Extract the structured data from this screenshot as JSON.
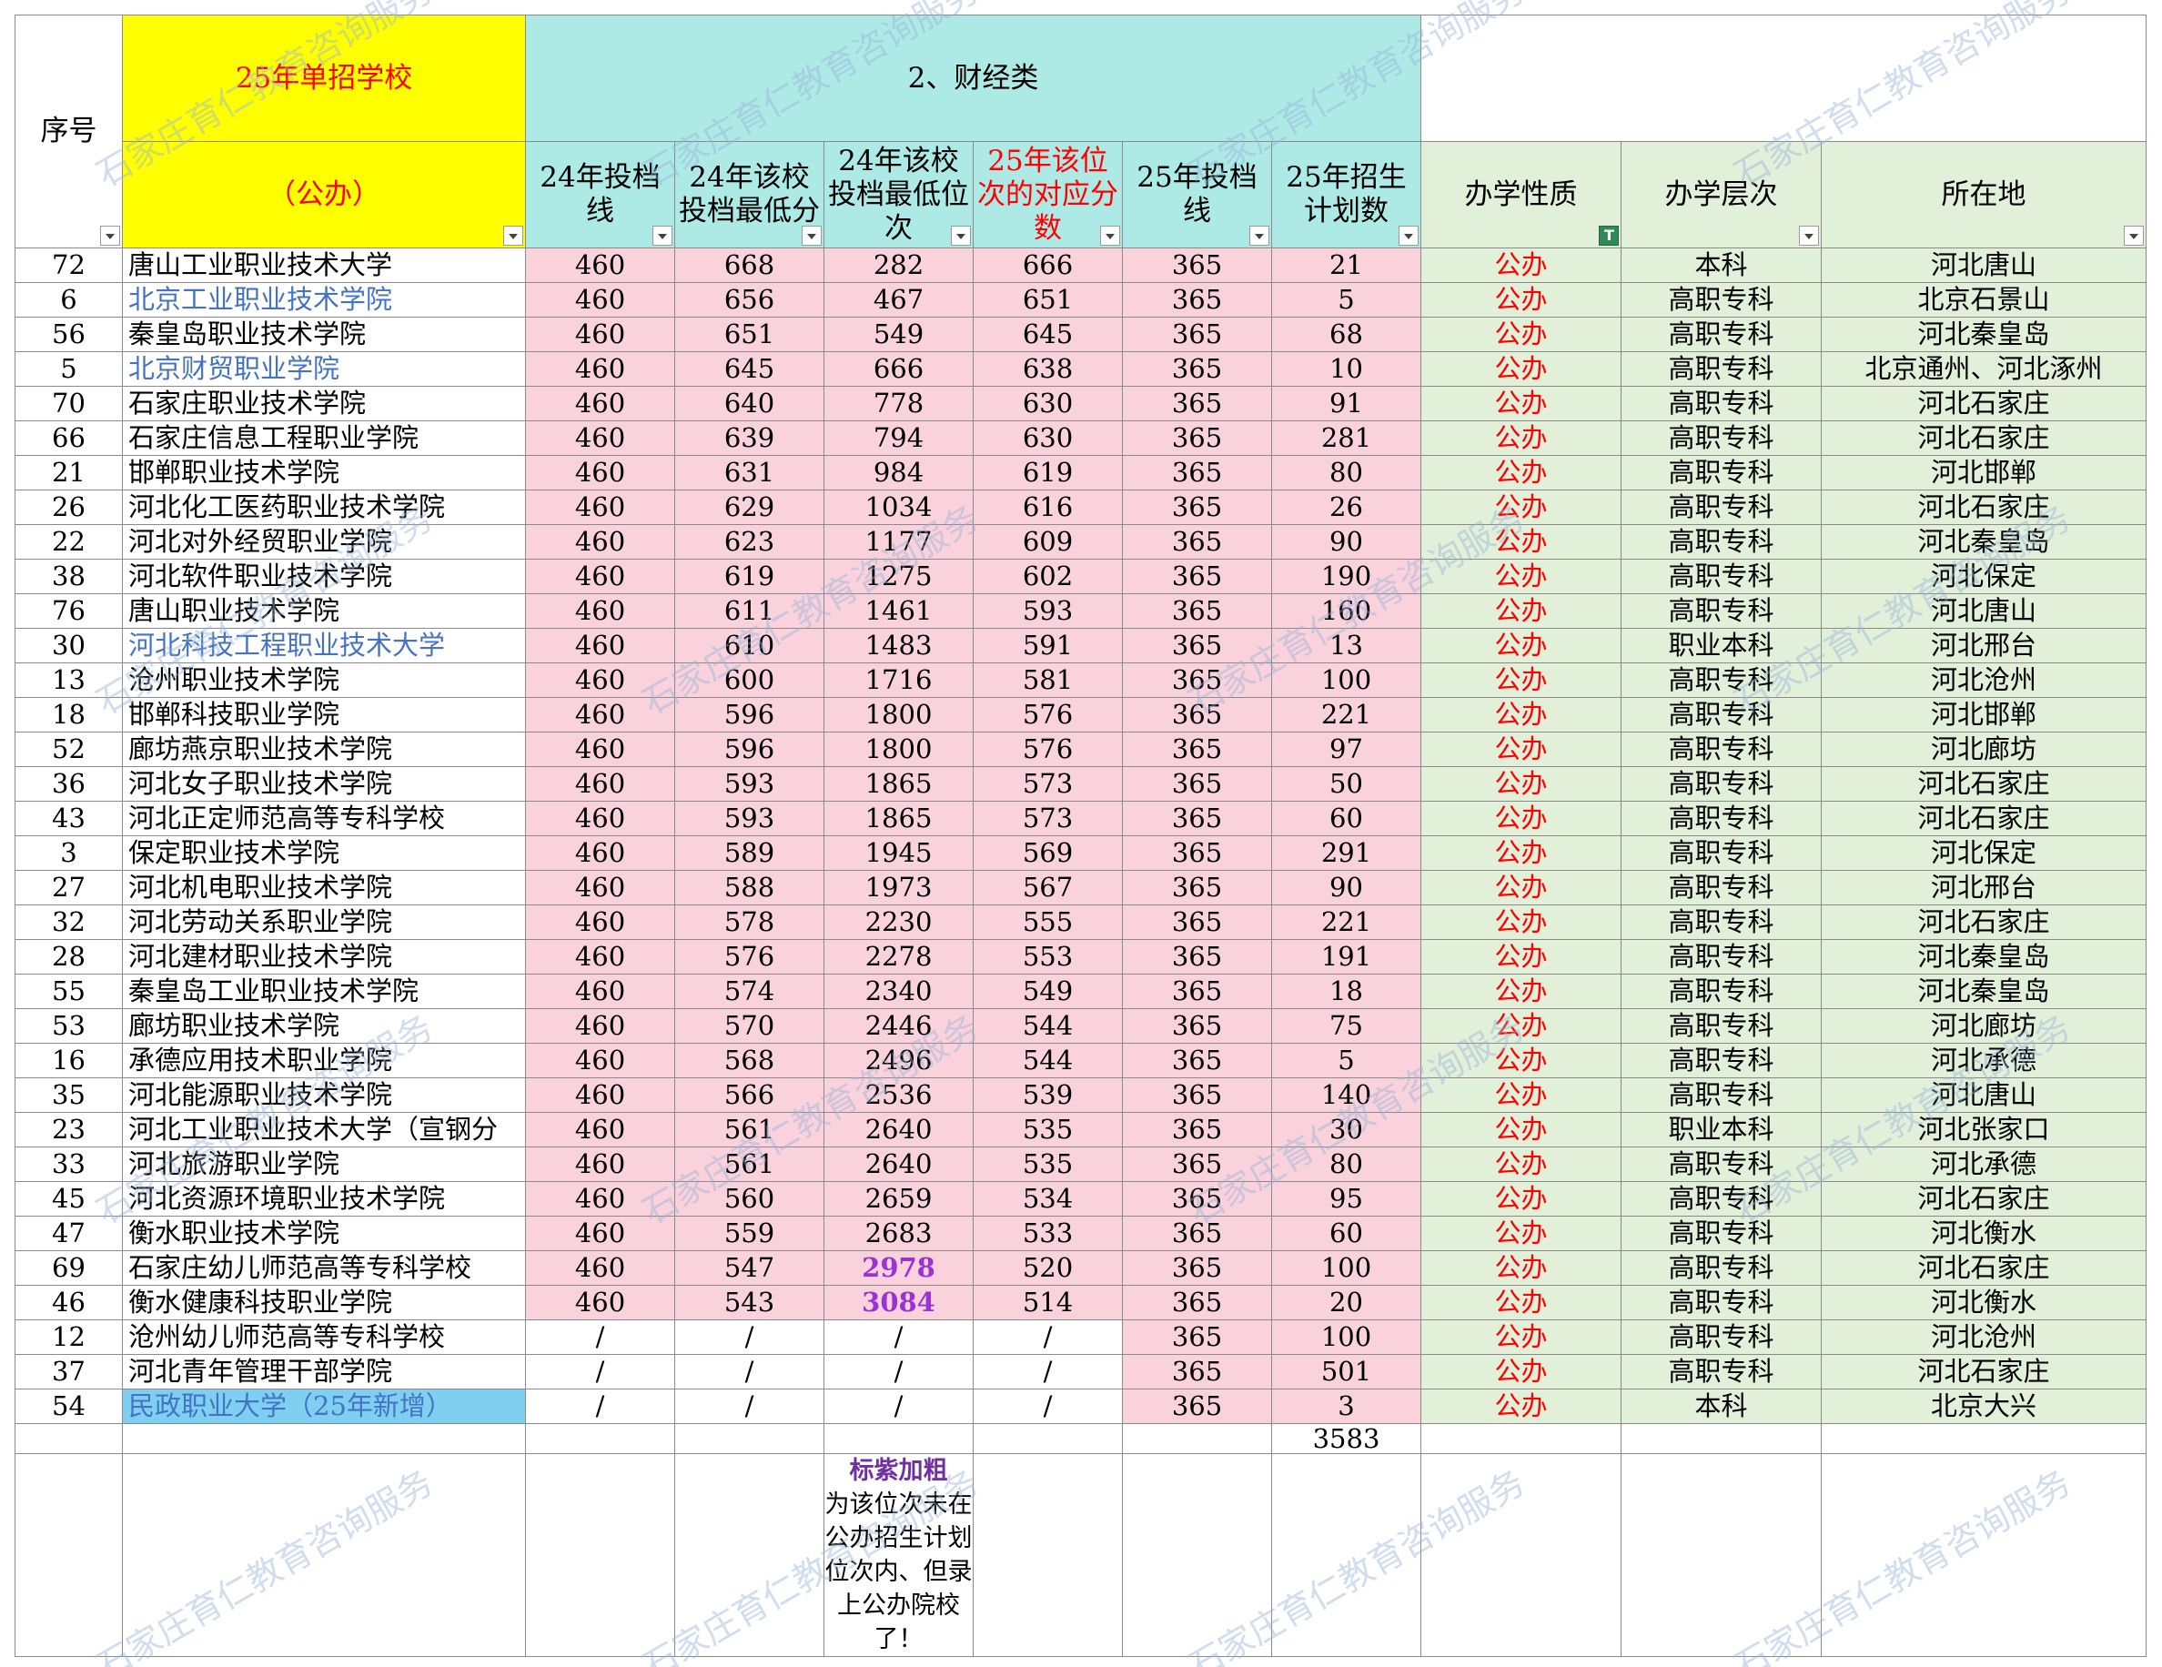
{
  "header": {
    "seq_label": "序号",
    "school_title": "25年单招学校",
    "school_sub": "（公办）",
    "category": "2、财经类",
    "col_24_line": "24年投档线",
    "col_24_min_score": "24年该校投档最低分",
    "col_24_min_rank": "24年该校投档最低位次",
    "col_25_score": "25年该位次的对应分数",
    "col_25_line": "25年投档线",
    "col_25_plan": "25年招生计划数",
    "col_type": "办学性质",
    "col_level": "办学层次",
    "col_location": "所在地"
  },
  "rows": [
    {
      "seq": "72",
      "name": "唐山工业职业技术大学",
      "line24": "460",
      "min24": "668",
      "rank24": "282",
      "score25": "666",
      "line25": "365",
      "plan25": "21",
      "type": "公办",
      "level": "本科",
      "loc": "河北唐山",
      "style": ""
    },
    {
      "seq": "6",
      "name": "北京工业职业技术学院",
      "line24": "460",
      "min24": "656",
      "rank24": "467",
      "score25": "651",
      "line25": "365",
      "plan25": "5",
      "type": "公办",
      "level": "高职专科",
      "loc": "北京石景山",
      "style": "link"
    },
    {
      "seq": "56",
      "name": "秦皇岛职业技术学院",
      "line24": "460",
      "min24": "651",
      "rank24": "549",
      "score25": "645",
      "line25": "365",
      "plan25": "68",
      "type": "公办",
      "level": "高职专科",
      "loc": "河北秦皇岛",
      "style": ""
    },
    {
      "seq": "5",
      "name": "北京财贸职业学院",
      "line24": "460",
      "min24": "645",
      "rank24": "666",
      "score25": "638",
      "line25": "365",
      "plan25": "10",
      "type": "公办",
      "level": "高职专科",
      "loc": "北京通州、河北涿州",
      "style": "link"
    },
    {
      "seq": "70",
      "name": "石家庄职业技术学院",
      "line24": "460",
      "min24": "640",
      "rank24": "778",
      "score25": "630",
      "line25": "365",
      "plan25": "91",
      "type": "公办",
      "level": "高职专科",
      "loc": "河北石家庄",
      "style": ""
    },
    {
      "seq": "66",
      "name": "石家庄信息工程职业学院",
      "line24": "460",
      "min24": "639",
      "rank24": "794",
      "score25": "630",
      "line25": "365",
      "plan25": "281",
      "type": "公办",
      "level": "高职专科",
      "loc": "河北石家庄",
      "style": ""
    },
    {
      "seq": "21",
      "name": "邯郸职业技术学院",
      "line24": "460",
      "min24": "631",
      "rank24": "984",
      "score25": "619",
      "line25": "365",
      "plan25": "80",
      "type": "公办",
      "level": "高职专科",
      "loc": "河北邯郸",
      "style": ""
    },
    {
      "seq": "26",
      "name": "河北化工医药职业技术学院",
      "line24": "460",
      "min24": "629",
      "rank24": "1034",
      "score25": "616",
      "line25": "365",
      "plan25": "26",
      "type": "公办",
      "level": "高职专科",
      "loc": "河北石家庄",
      "style": ""
    },
    {
      "seq": "22",
      "name": "河北对外经贸职业学院",
      "line24": "460",
      "min24": "623",
      "rank24": "1177",
      "score25": "609",
      "line25": "365",
      "plan25": "90",
      "type": "公办",
      "level": "高职专科",
      "loc": "河北秦皇岛",
      "style": ""
    },
    {
      "seq": "38",
      "name": "河北软件职业技术学院",
      "line24": "460",
      "min24": "619",
      "rank24": "1275",
      "score25": "602",
      "line25": "365",
      "plan25": "190",
      "type": "公办",
      "level": "高职专科",
      "loc": "河北保定",
      "style": ""
    },
    {
      "seq": "76",
      "name": "唐山职业技术学院",
      "line24": "460",
      "min24": "611",
      "rank24": "1461",
      "score25": "593",
      "line25": "365",
      "plan25": "160",
      "type": "公办",
      "level": "高职专科",
      "loc": "河北唐山",
      "style": ""
    },
    {
      "seq": "30",
      "name": "河北科技工程职业技术大学",
      "line24": "460",
      "min24": "610",
      "rank24": "1483",
      "score25": "591",
      "line25": "365",
      "plan25": "13",
      "type": "公办",
      "level": "职业本科",
      "loc": "河北邢台",
      "style": "link"
    },
    {
      "seq": "13",
      "name": "沧州职业技术学院",
      "line24": "460",
      "min24": "600",
      "rank24": "1716",
      "score25": "581",
      "line25": "365",
      "plan25": "100",
      "type": "公办",
      "level": "高职专科",
      "loc": "河北沧州",
      "style": ""
    },
    {
      "seq": "18",
      "name": "邯郸科技职业学院",
      "line24": "460",
      "min24": "596",
      "rank24": "1800",
      "score25": "576",
      "line25": "365",
      "plan25": "221",
      "type": "公办",
      "level": "高职专科",
      "loc": "河北邯郸",
      "style": ""
    },
    {
      "seq": "52",
      "name": "廊坊燕京职业技术学院",
      "line24": "460",
      "min24": "596",
      "rank24": "1800",
      "score25": "576",
      "line25": "365",
      "plan25": "97",
      "type": "公办",
      "level": "高职专科",
      "loc": "河北廊坊",
      "style": ""
    },
    {
      "seq": "36",
      "name": "河北女子职业技术学院",
      "line24": "460",
      "min24": "593",
      "rank24": "1865",
      "score25": "573",
      "line25": "365",
      "plan25": "50",
      "type": "公办",
      "level": "高职专科",
      "loc": "河北石家庄",
      "style": ""
    },
    {
      "seq": "43",
      "name": "河北正定师范高等专科学校",
      "line24": "460",
      "min24": "593",
      "rank24": "1865",
      "score25": "573",
      "line25": "365",
      "plan25": "60",
      "type": "公办",
      "level": "高职专科",
      "loc": "河北石家庄",
      "style": ""
    },
    {
      "seq": "3",
      "name": "保定职业技术学院",
      "line24": "460",
      "min24": "589",
      "rank24": "1945",
      "score25": "569",
      "line25": "365",
      "plan25": "291",
      "type": "公办",
      "level": "高职专科",
      "loc": "河北保定",
      "style": ""
    },
    {
      "seq": "27",
      "name": "河北机电职业技术学院",
      "line24": "460",
      "min24": "588",
      "rank24": "1973",
      "score25": "567",
      "line25": "365",
      "plan25": "90",
      "type": "公办",
      "level": "高职专科",
      "loc": "河北邢台",
      "style": ""
    },
    {
      "seq": "32",
      "name": "河北劳动关系职业学院",
      "line24": "460",
      "min24": "578",
      "rank24": "2230",
      "score25": "555",
      "line25": "365",
      "plan25": "221",
      "type": "公办",
      "level": "高职专科",
      "loc": "河北石家庄",
      "style": ""
    },
    {
      "seq": "28",
      "name": "河北建材职业技术学院",
      "line24": "460",
      "min24": "576",
      "rank24": "2278",
      "score25": "553",
      "line25": "365",
      "plan25": "191",
      "type": "公办",
      "level": "高职专科",
      "loc": "河北秦皇岛",
      "style": ""
    },
    {
      "seq": "55",
      "name": "秦皇岛工业职业技术学院",
      "line24": "460",
      "min24": "574",
      "rank24": "2340",
      "score25": "549",
      "line25": "365",
      "plan25": "18",
      "type": "公办",
      "level": "高职专科",
      "loc": "河北秦皇岛",
      "style": ""
    },
    {
      "seq": "53",
      "name": "廊坊职业技术学院",
      "line24": "460",
      "min24": "570",
      "rank24": "2446",
      "score25": "544",
      "line25": "365",
      "plan25": "75",
      "type": "公办",
      "level": "高职专科",
      "loc": "河北廊坊",
      "style": ""
    },
    {
      "seq": "16",
      "name": "承德应用技术职业学院",
      "line24": "460",
      "min24": "568",
      "rank24": "2496",
      "score25": "544",
      "line25": "365",
      "plan25": "5",
      "type": "公办",
      "level": "高职专科",
      "loc": "河北承德",
      "style": ""
    },
    {
      "seq": "35",
      "name": "河北能源职业技术学院",
      "line24": "460",
      "min24": "566",
      "rank24": "2536",
      "score25": "539",
      "line25": "365",
      "plan25": "140",
      "type": "公办",
      "level": "高职专科",
      "loc": "河北唐山",
      "style": ""
    },
    {
      "seq": "23",
      "name": "河北工业职业技术大学（宣钢分",
      "line24": "460",
      "min24": "561",
      "rank24": "2640",
      "score25": "535",
      "line25": "365",
      "plan25": "30",
      "type": "公办",
      "level": "职业本科",
      "loc": "河北张家口",
      "style": ""
    },
    {
      "seq": "33",
      "name": "河北旅游职业学院",
      "line24": "460",
      "min24": "561",
      "rank24": "2640",
      "score25": "535",
      "line25": "365",
      "plan25": "80",
      "type": "公办",
      "level": "高职专科",
      "loc": "河北承德",
      "style": ""
    },
    {
      "seq": "45",
      "name": "河北资源环境职业技术学院",
      "line24": "460",
      "min24": "560",
      "rank24": "2659",
      "score25": "534",
      "line25": "365",
      "plan25": "95",
      "type": "公办",
      "level": "高职专科",
      "loc": "河北石家庄",
      "style": ""
    },
    {
      "seq": "47",
      "name": "衡水职业技术学院",
      "line24": "460",
      "min24": "559",
      "rank24": "2683",
      "score25": "533",
      "line25": "365",
      "plan25": "60",
      "type": "公办",
      "level": "高职专科",
      "loc": "河北衡水",
      "style": ""
    },
    {
      "seq": "69",
      "name": "石家庄幼儿师范高等专科学校",
      "line24": "460",
      "min24": "547",
      "rank24": "2978",
      "score25": "520",
      "line25": "365",
      "plan25": "100",
      "type": "公办",
      "level": "高职专科",
      "loc": "河北石家庄",
      "style": "",
      "rank_purple": true
    },
    {
      "seq": "46",
      "name": "衡水健康科技职业学院",
      "line24": "460",
      "min24": "543",
      "rank24": "3084",
      "score25": "514",
      "line25": "365",
      "plan25": "20",
      "type": "公办",
      "level": "高职专科",
      "loc": "河北衡水",
      "style": "",
      "rank_purple": true
    },
    {
      "seq": "12",
      "name": "沧州幼儿师范高等专科学校",
      "line24": "/",
      "min24": "/",
      "rank24": "/",
      "score25": "/",
      "line25": "365",
      "plan25": "100",
      "type": "公办",
      "level": "高职专科",
      "loc": "河北沧州",
      "style": "",
      "white": true
    },
    {
      "seq": "37",
      "name": "河北青年管理干部学院",
      "line24": "/",
      "min24": "/",
      "rank24": "/",
      "score25": "/",
      "line25": "365",
      "plan25": "501",
      "type": "公办",
      "level": "高职专科",
      "loc": "河北石家庄",
      "style": "",
      "white": true
    },
    {
      "seq": "54",
      "name": "民政职业大学（25年新增）",
      "line24": "/",
      "min24": "/",
      "rank24": "/",
      "score25": "/",
      "line25": "365",
      "plan25": "3",
      "type": "公办",
      "level": "本科",
      "loc": "北京大兴",
      "style": "link",
      "white": true,
      "name_bg": "blue"
    }
  ],
  "total_plan": "3583",
  "note": {
    "title": "标紫加粗",
    "body": "为该位次未在公办招生计划位次内、但录上公办院校了！"
  },
  "watermark": "石家庄育仁教育咨询服务",
  "colors": {
    "yellow": "#ffff00",
    "cyan": "#aeeae5",
    "pink": "#f9d2db",
    "green": "#e2f0d9",
    "red": "#ff0000",
    "purple": "#9b32d3"
  }
}
